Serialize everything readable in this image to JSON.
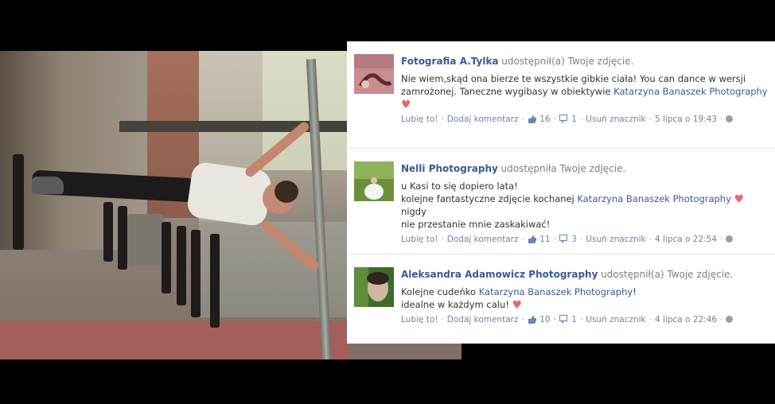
{
  "posts": [
    {
      "author": "Fotografia A.Tylka",
      "shared": "udostępnił(a) Twoje zdjęcie.",
      "lines": [
        "Nie wiem,skąd ona bierze te wszystkie gibkie ciała! You can dance w wersji",
        "zamrożonej. Taneczne wygibasy w obiektywie "
      ],
      "page_mention": "Katarzyna Banaszek Photography",
      "like": "Lubię to!",
      "comment": "Dodaj komentarz",
      "likes": "16",
      "shares": "1",
      "remove_tag": "Usuń znacznik",
      "date": "5 lipca o 19:43"
    },
    {
      "author": "Nelli Photography",
      "shared": "udostępniła Twoje zdjęcie.",
      "line1": "u Kasi to się dopiero lata!",
      "line2": "kolejne fantastyczne zdjęcie kochanej ",
      "page_mention": "Katarzyna Banaszek Photography",
      "line2_tail": " nigdy",
      "line3": "nie przestanie mnie zaskakiwać!",
      "like": "Lubię to!",
      "comment": "Dodaj komentarz",
      "likes": "11",
      "shares": "3",
      "remove_tag": "Usuń znacznik",
      "date": "4 lipca o 22:54"
    },
    {
      "author": "Aleksandra Adamowicz Photography",
      "shared": "udostępnił(a) Twoje zdjęcie.",
      "line1": "Kolejne cudeńko ",
      "page_mention": "Katarzyna Banaszek Photography",
      "line1_tail": "!",
      "line2": "idealne w każdym calu! ",
      "like": "Lubię to!",
      "comment": "Dodaj komentarz",
      "likes": "10",
      "shares": "1",
      "remove_tag": "Usuń znacznik",
      "date": "4 lipca o 22:46"
    }
  ],
  "colors": {
    "link": "#3b5998",
    "heart": "#e06a72"
  }
}
